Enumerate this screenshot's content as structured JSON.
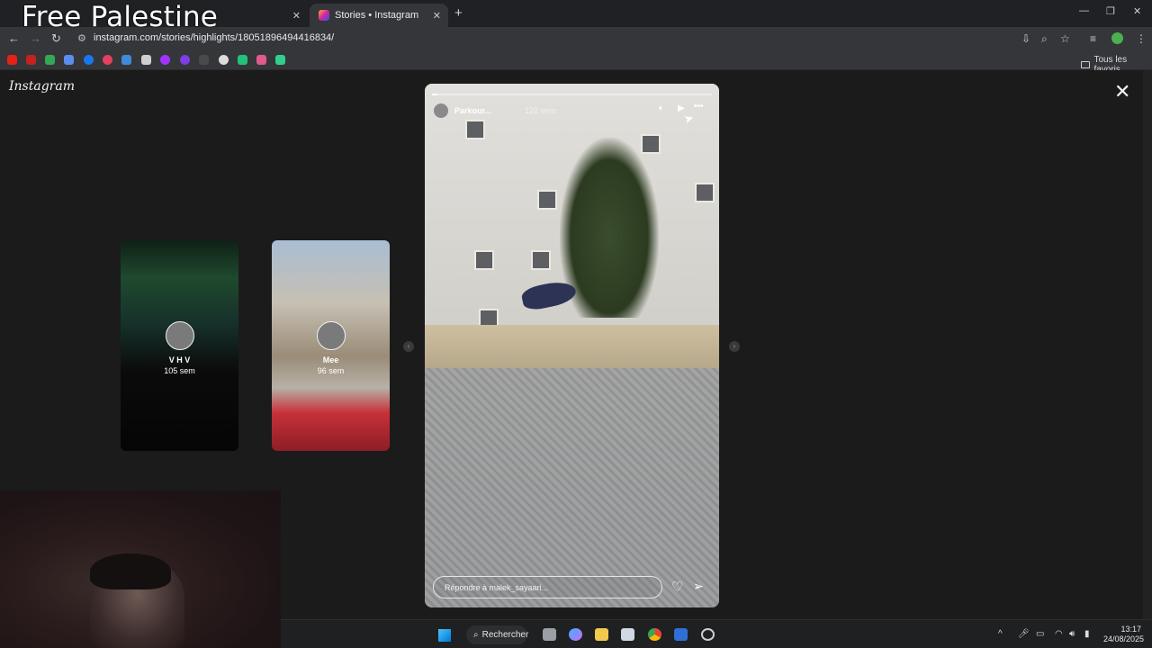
{
  "watermark": "Free Palestine",
  "tabs": [
    {
      "label": "",
      "active": false
    },
    {
      "label": "Stories • Instagram",
      "active": true
    }
  ],
  "browser": {
    "url": "instagram.com/stories/highlights/18051896494416834/",
    "bookmarks_folder": "Tous les favoris"
  },
  "icons": {
    "back": "arrow-left-icon",
    "forward": "arrow-right-icon",
    "reload": "reload-icon",
    "close": "close-icon",
    "mute": "speaker-icon",
    "play": "play-icon",
    "more": "more-icon",
    "heart": "heart-icon",
    "send": "send-icon"
  },
  "page": {
    "logo": "Instagram",
    "side_stories": [
      {
        "name": "V  H  V",
        "time": "105 sem"
      },
      {
        "name": "Mee",
        "time": "96 sem"
      }
    ],
    "story": {
      "username": "Parkour...",
      "time": "122 sem",
      "reply_placeholder": "Répondre à malek_sayaari...",
      "progress": 0.02
    }
  },
  "taskbar": {
    "search_label": "Rechercher",
    "time": "13:17",
    "date": "24/08/2025"
  },
  "colors": {
    "background": "#1b1b1b",
    "tab_active": "#35363a",
    "accent": "#0078d4"
  }
}
